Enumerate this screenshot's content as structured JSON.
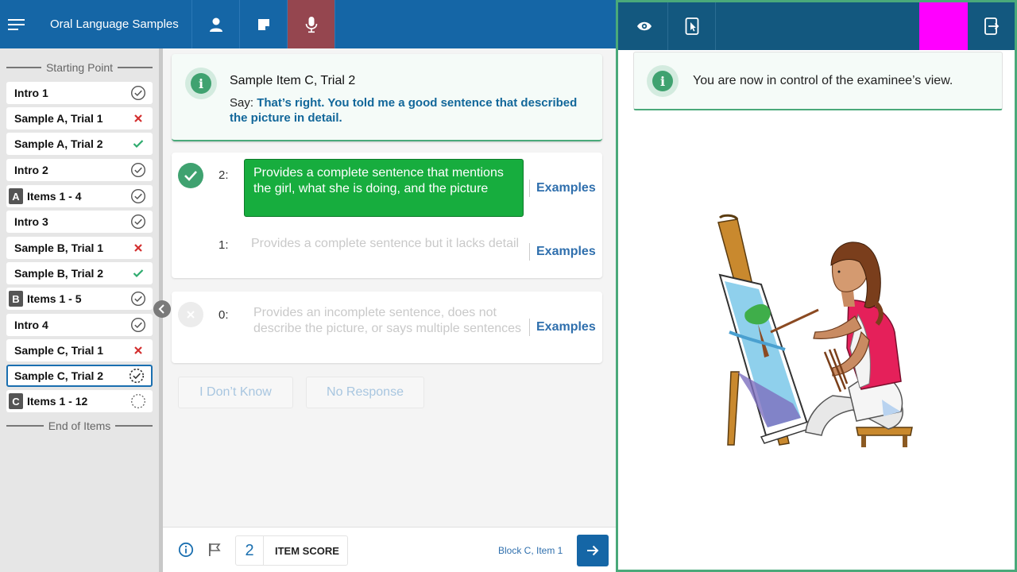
{
  "header": {
    "title": "Oral Language Samples"
  },
  "sidebar": {
    "start_label": "Starting Point",
    "end_label": "End of Items",
    "items": [
      {
        "label": "Intro 1",
        "badge": "",
        "status": "complete"
      },
      {
        "label": "Sample A, Trial 1",
        "badge": "",
        "status": "incorrect"
      },
      {
        "label": "Sample A, Trial 2",
        "badge": "",
        "status": "correct"
      },
      {
        "label": "Intro 2",
        "badge": "",
        "status": "complete"
      },
      {
        "label": "Items 1 - 4",
        "badge": "A",
        "status": "complete"
      },
      {
        "label": "Intro 3",
        "badge": "",
        "status": "complete"
      },
      {
        "label": "Sample B, Trial 1",
        "badge": "",
        "status": "incorrect"
      },
      {
        "label": "Sample B, Trial 2",
        "badge": "",
        "status": "correct"
      },
      {
        "label": "Items 1 - 5",
        "badge": "B",
        "status": "complete"
      },
      {
        "label": "Intro 4",
        "badge": "",
        "status": "complete"
      },
      {
        "label": "Sample C, Trial 1",
        "badge": "",
        "status": "incorrect"
      },
      {
        "label": "Sample C, Trial 2",
        "badge": "",
        "status": "in-progress"
      },
      {
        "label": "Items 1 - 12",
        "badge": "C",
        "status": "not-started"
      }
    ]
  },
  "prompt": {
    "title": "Sample Item C, Trial 2",
    "say_label": "Say:",
    "say_text": "That’s right. You told me a good sentence that described the picture in detail."
  },
  "scores": [
    {
      "value": "2:",
      "text": "Provides a complete sentence that mentions the girl, what she is doing, and the picture",
      "link": "Examples",
      "selected": true
    },
    {
      "value": "1:",
      "text": "Provides a complete sentence but it lacks detail",
      "link": "Examples",
      "selected": false
    },
    {
      "value": "0:",
      "text": "Provides an incomplete sentence, does not describe the picture, or says multiple sentences",
      "link": "Examples",
      "selected": false
    }
  ],
  "actions": {
    "dont_know": "I Don’t Know",
    "no_response": "No Response"
  },
  "footer": {
    "score_value": "2",
    "score_label": "ITEM SCORE",
    "block_label": "Block C, Item 1"
  },
  "examinee": {
    "notice": "You are now in control of the examinee’s view."
  },
  "colors": {
    "primary": "#1566a6",
    "active_tab": "#95464f",
    "selected_score": "#17ad3e",
    "accent_green": "#4aa97a",
    "incorrect": "#d32f2f",
    "correct": "#2eab6e",
    "placeholder_magenta": "#ff00ff"
  }
}
